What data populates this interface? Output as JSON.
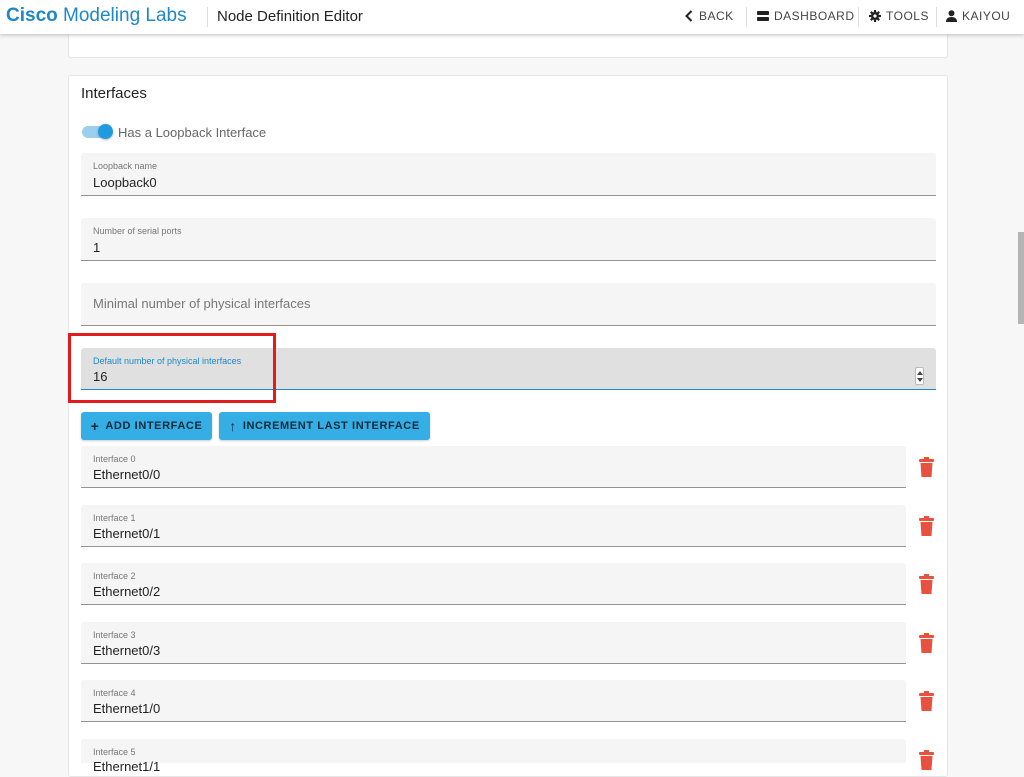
{
  "header": {
    "brand_bold": "Cisco",
    "brand_light": "Modeling Labs",
    "page_title": "Node Definition Editor",
    "nav": {
      "back": "BACK",
      "dashboard": "DASHBOARD",
      "tools": "TOOLS",
      "user": "KAIYOU"
    }
  },
  "interfaces": {
    "title": "Interfaces",
    "loopback_toggle": {
      "label": "Has a Loopback Interface",
      "on": true
    },
    "loopback_name": {
      "label": "Loopback name",
      "value": "Loopback0"
    },
    "serial_ports": {
      "label": "Number of serial ports",
      "value": "1"
    },
    "min_physical": {
      "placeholder": "Minimal number of physical interfaces"
    },
    "default_physical": {
      "label": "Default number of physical interfaces",
      "value": "16"
    },
    "buttons": {
      "add": "ADD INTERFACE",
      "increment": "INCREMENT LAST INTERFACE"
    },
    "items": [
      {
        "label": "Interface 0",
        "value": "Ethernet0/0"
      },
      {
        "label": "Interface 1",
        "value": "Ethernet0/1"
      },
      {
        "label": "Interface 2",
        "value": "Ethernet0/2"
      },
      {
        "label": "Interface 3",
        "value": "Ethernet0/3"
      },
      {
        "label": "Interface 4",
        "value": "Ethernet1/0"
      },
      {
        "label": "Interface 5",
        "value": "Ethernet1/1"
      }
    ]
  },
  "colors": {
    "brand": "#1e88c7",
    "primary_button": "#35aee6",
    "delete_icon": "#e8503f",
    "highlight": "#e41b1b"
  },
  "icons": [
    "chevron-left-icon",
    "dashboard-icon",
    "gear-icon",
    "user-icon",
    "plus-icon",
    "arrow-up-icon",
    "trash-icon"
  ]
}
